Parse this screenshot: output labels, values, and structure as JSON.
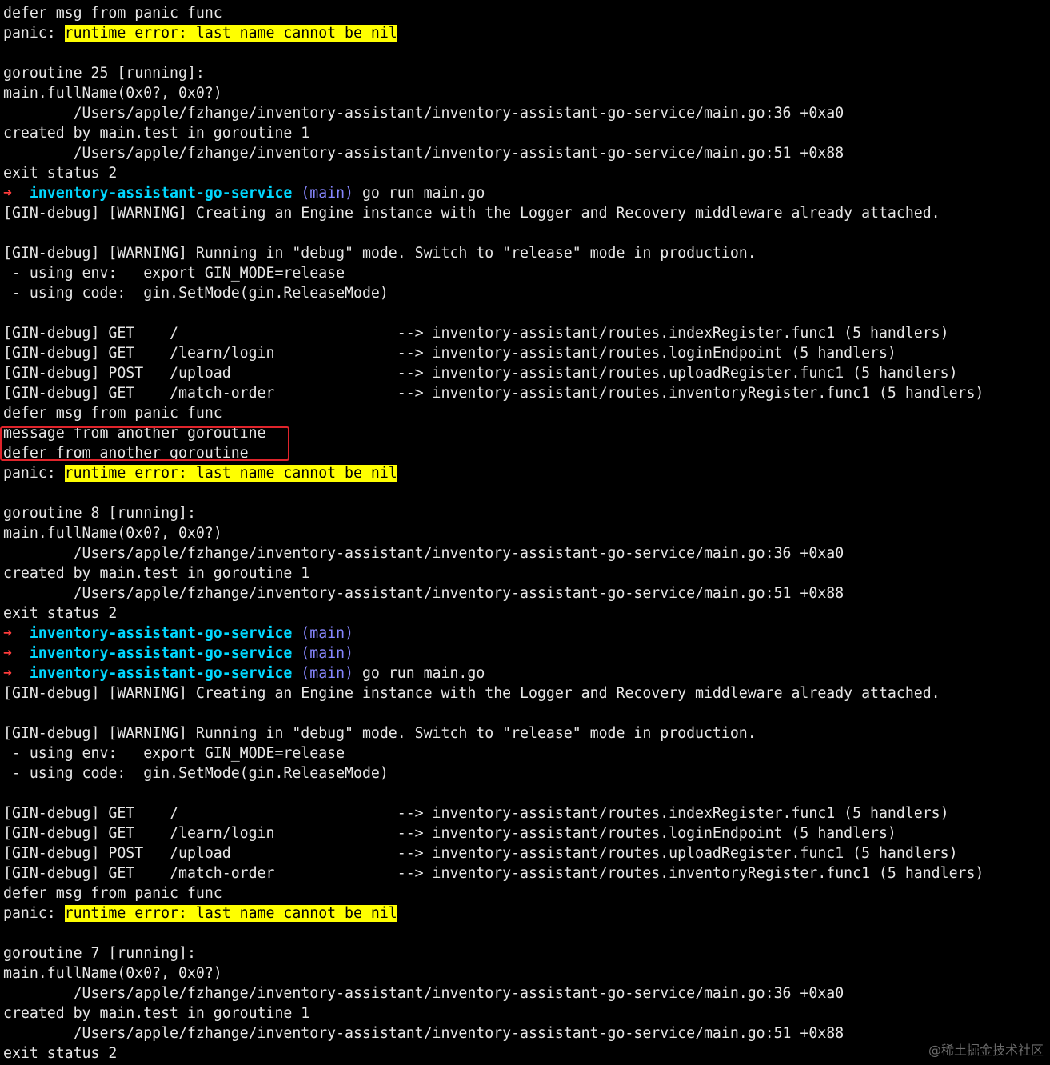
{
  "terminal": {
    "lines": [
      {
        "type": "text",
        "text": "defer msg from panic func"
      },
      {
        "type": "panic",
        "prefix": "panic: ",
        "highlight": "runtime error: last name cannot be nil"
      },
      {
        "type": "text",
        "text": ""
      },
      {
        "type": "text",
        "text": "goroutine 25 [running]:"
      },
      {
        "type": "text",
        "text": "main.fullName(0x0?, 0x0?)"
      },
      {
        "type": "text",
        "text": "        /Users/apple/fzhange/inventory-assistant/inventory-assistant-go-service/main.go:36 +0xa0"
      },
      {
        "type": "text",
        "text": "created by main.test in goroutine 1"
      },
      {
        "type": "text",
        "text": "        /Users/apple/fzhange/inventory-assistant/inventory-assistant-go-service/main.go:51 +0x88"
      },
      {
        "type": "text",
        "text": "exit status 2"
      },
      {
        "type": "prompt",
        "arrow": "➜",
        "dir": "inventory-assistant-go-service",
        "branch": "(main)",
        "cmd": "go run main.go"
      },
      {
        "type": "text",
        "text": "[GIN-debug] [WARNING] Creating an Engine instance with the Logger and Recovery middleware already attached."
      },
      {
        "type": "text",
        "text": ""
      },
      {
        "type": "text",
        "text": "[GIN-debug] [WARNING] Running in \"debug\" mode. Switch to \"release\" mode in production."
      },
      {
        "type": "text",
        "text": " - using env:   export GIN_MODE=release"
      },
      {
        "type": "text",
        "text": " - using code:  gin.SetMode(gin.ReleaseMode)"
      },
      {
        "type": "text",
        "text": ""
      },
      {
        "type": "text",
        "text": "[GIN-debug] GET    /                         --> inventory-assistant/routes.indexRegister.func1 (5 handlers)"
      },
      {
        "type": "text",
        "text": "[GIN-debug] GET    /learn/login              --> inventory-assistant/routes.loginEndpoint (5 handlers)"
      },
      {
        "type": "text",
        "text": "[GIN-debug] POST   /upload                   --> inventory-assistant/routes.uploadRegister.func1 (5 handlers)"
      },
      {
        "type": "text",
        "text": "[GIN-debug] GET    /match-order              --> inventory-assistant/routes.inventoryRegister.func1 (5 handlers)"
      },
      {
        "type": "text",
        "text": "defer msg from panic func"
      },
      {
        "type": "text",
        "text": "message from another goroutine"
      },
      {
        "type": "text",
        "text": "defer from another goroutine"
      },
      {
        "type": "panic",
        "prefix": "panic: ",
        "highlight": "runtime error: last name cannot be nil"
      },
      {
        "type": "text",
        "text": ""
      },
      {
        "type": "text",
        "text": "goroutine 8 [running]:"
      },
      {
        "type": "text",
        "text": "main.fullName(0x0?, 0x0?)"
      },
      {
        "type": "text",
        "text": "        /Users/apple/fzhange/inventory-assistant/inventory-assistant-go-service/main.go:36 +0xa0"
      },
      {
        "type": "text",
        "text": "created by main.test in goroutine 1"
      },
      {
        "type": "text",
        "text": "        /Users/apple/fzhange/inventory-assistant/inventory-assistant-go-service/main.go:51 +0x88"
      },
      {
        "type": "text",
        "text": "exit status 2"
      },
      {
        "type": "prompt",
        "arrow": "➜",
        "dir": "inventory-assistant-go-service",
        "branch": "(main)",
        "cmd": ""
      },
      {
        "type": "prompt",
        "arrow": "➜",
        "dir": "inventory-assistant-go-service",
        "branch": "(main)",
        "cmd": ""
      },
      {
        "type": "prompt",
        "arrow": "➜",
        "dir": "inventory-assistant-go-service",
        "branch": "(main)",
        "cmd": "go run main.go"
      },
      {
        "type": "text",
        "text": "[GIN-debug] [WARNING] Creating an Engine instance with the Logger and Recovery middleware already attached."
      },
      {
        "type": "text",
        "text": ""
      },
      {
        "type": "text",
        "text": "[GIN-debug] [WARNING] Running in \"debug\" mode. Switch to \"release\" mode in production."
      },
      {
        "type": "text",
        "text": " - using env:   export GIN_MODE=release"
      },
      {
        "type": "text",
        "text": " - using code:  gin.SetMode(gin.ReleaseMode)"
      },
      {
        "type": "text",
        "text": ""
      },
      {
        "type": "text",
        "text": "[GIN-debug] GET    /                         --> inventory-assistant/routes.indexRegister.func1 (5 handlers)"
      },
      {
        "type": "text",
        "text": "[GIN-debug] GET    /learn/login              --> inventory-assistant/routes.loginEndpoint (5 handlers)"
      },
      {
        "type": "text",
        "text": "[GIN-debug] POST   /upload                   --> inventory-assistant/routes.uploadRegister.func1 (5 handlers)"
      },
      {
        "type": "text",
        "text": "[GIN-debug] GET    /match-order              --> inventory-assistant/routes.inventoryRegister.func1 (5 handlers)"
      },
      {
        "type": "text",
        "text": "defer msg from panic func"
      },
      {
        "type": "panic",
        "prefix": "panic: ",
        "highlight": "runtime error: last name cannot be nil"
      },
      {
        "type": "text",
        "text": ""
      },
      {
        "type": "text",
        "text": "goroutine 7 [running]:"
      },
      {
        "type": "text",
        "text": "main.fullName(0x0?, 0x0?)"
      },
      {
        "type": "text",
        "text": "        /Users/apple/fzhange/inventory-assistant/inventory-assistant-go-service/main.go:36 +0xa0"
      },
      {
        "type": "text",
        "text": "created by main.test in goroutine 1"
      },
      {
        "type": "text",
        "text": "        /Users/apple/fzhange/inventory-assistant/inventory-assistant-go-service/main.go:51 +0x88"
      },
      {
        "type": "text",
        "text": "exit status 2"
      }
    ]
  },
  "watermark": "@稀土掘金技术社区",
  "colors": {
    "background": "#000000",
    "foreground": "#e6e6e6",
    "panic_highlight": "#ffff00",
    "prompt_arrow": "#ff3b3b",
    "prompt_dir": "#00d7ff",
    "prompt_branch": "#8787ff",
    "annotation_box": "#e0242b"
  }
}
